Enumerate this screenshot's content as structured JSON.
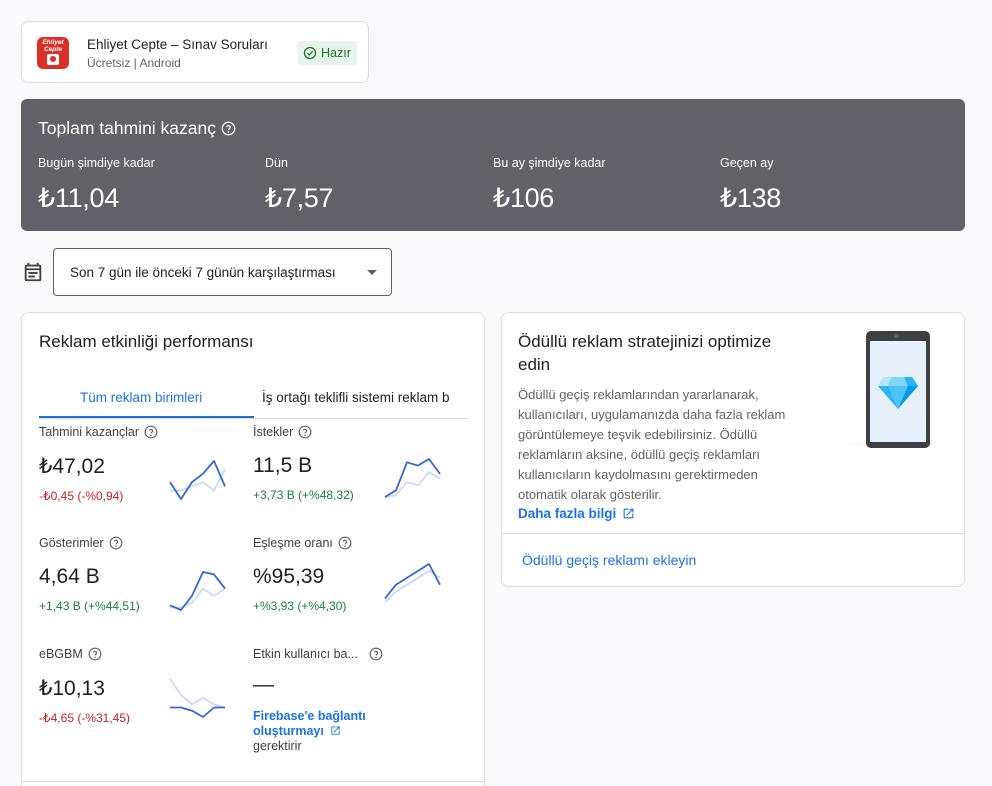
{
  "app": {
    "name": "Ehliyet Cepte – Sınav Soruları",
    "meta": "Ücretsiz | Android",
    "status": "Hazır",
    "icon_text": "Ehliyet Cepte"
  },
  "earnings": {
    "title": "Toplam tahmini kazanç",
    "columns": [
      {
        "label": "Bugün şimdiye kadar",
        "value": "₺11,04"
      },
      {
        "label": "Dün",
        "value": "₺7,57"
      },
      {
        "label": "Bu ay şimdiye kadar",
        "value": "₺106"
      },
      {
        "label": "Geçen ay",
        "value": "₺138"
      }
    ]
  },
  "date_range": {
    "label": "Son 7 gün ile önceki 7 günün karşılaştırması"
  },
  "performance": {
    "title": "Reklam etkinliği performansı",
    "tabs": [
      "Tüm reklam birimleri",
      "İş ortağı teklifli sistemi reklam b"
    ],
    "metrics": [
      {
        "label": "Tahmini kazançlar",
        "value": "₺47,02",
        "change": "-₺0,45 (-%0,94)",
        "trend": "negative",
        "current": [
          13,
          9,
          13,
          15,
          18,
          12
        ],
        "previous": [
          11,
          11,
          12,
          13,
          11,
          16
        ]
      },
      {
        "label": "İstekler",
        "value": "11,5 B",
        "change": "+3,73 B (+%48,32)",
        "trend": "positive",
        "current": [
          5,
          9,
          26,
          24,
          28,
          19
        ],
        "previous": [
          5,
          6,
          14,
          12,
          20,
          16
        ]
      },
      {
        "label": "Gösterimler",
        "value": "4,64 B",
        "change": "+1,43 B (+%44,51)",
        "trend": "positive",
        "current": [
          4,
          2,
          8,
          18,
          17,
          11
        ],
        "previous": [
          3,
          3,
          5,
          11,
          8,
          11
        ]
      },
      {
        "label": "Eşleşme oranı",
        "value": "%95,39",
        "change": "+%3,93 (+%4,30)",
        "trend": "positive",
        "current": [
          93,
          95,
          96,
          97,
          98,
          95
        ],
        "previous": [
          92.5,
          94,
          95,
          96,
          97,
          96
        ]
      },
      {
        "label": "eBGBM",
        "value": "₺10,13",
        "change": "-₺4,65 (-%31,45)",
        "trend": "negative",
        "current": [
          10,
          10,
          9,
          7,
          10,
          10
        ],
        "previous": [
          19,
          14,
          11,
          13,
          11,
          10
        ]
      },
      {
        "label": "Etkin kullanıcı ba...",
        "value": "—",
        "link": "Firebase'e bağlantı oluşturmayı",
        "note": "gerektirir"
      }
    ],
    "colors": {
      "current": "#3367d6",
      "previous": "#c6dafc",
      "negative": "#c5221f",
      "positive": "#188038"
    }
  },
  "rewarded": {
    "title": "Ödüllü reklam stratejinizi optimize edin",
    "body": "Ödüllü geçiş reklamlarından yararlanarak, kullanıcıları, uygulamanızda daha fazla reklam görüntülemeye teşvik edebilirsiniz. Ödüllü reklamların aksine, ödüllü geçiş reklamları kullanıcıların kaydolmasını gerektirmeden otomatik olarak gösterilir.",
    "more_link": "Daha fazla bilgi",
    "cta": "Ödüllü geçiş reklamı ekleyin"
  },
  "icons": [
    "app-icon",
    "check-circle-icon",
    "help-icon",
    "calendar-icon",
    "dropdown-caret-icon",
    "open-in-new-icon",
    "phone-illustration",
    "diamond-icon"
  ],
  "accent": "#1a73e8",
  "summary_bg": "#5f6368"
}
